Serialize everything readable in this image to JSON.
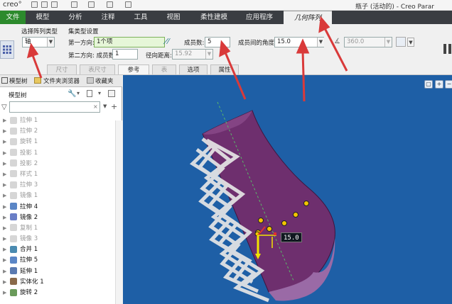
{
  "titlebar": {
    "logo": "creo°",
    "window_title": "瓶子 (活动的) - Creo Parar"
  },
  "ribbon": {
    "tabs": [
      "文件",
      "模型",
      "分析",
      "注释",
      "工具",
      "视图",
      "柔性建模",
      "应用程序"
    ],
    "active_tab": "几何阵列"
  },
  "panel": {
    "pattern_type_label": "选择阵列类型",
    "pattern_type_value": "轴",
    "set_type_label": "集类型设置",
    "dir1_label": "第一方向:",
    "dir1_value": "1个项",
    "members_label1": "成员数:",
    "members_value1": "5",
    "angle_label": "成员间的角度:",
    "angle_value": "15.0",
    "angle_extent_value": "360.0",
    "dir2_label": "第二方向: 成员数:",
    "dir2_value": "1",
    "radial_label": "径向距离:",
    "radial_value": "15.92",
    "subtabs": [
      "尺寸",
      "表尺寸",
      "参考",
      "表",
      "选项",
      "属性"
    ]
  },
  "nav": {
    "tabs": [
      "模型树",
      "文件夹浏览器",
      "收藏夹"
    ],
    "tree_header": "模型树",
    "search_placeholder": ""
  },
  "tree": [
    {
      "label": "拉伸 1",
      "state": "gray",
      "icon": "extrude-icon"
    },
    {
      "label": "拉伸 2",
      "state": "gray",
      "icon": "extrude-icon"
    },
    {
      "label": "旋转 1",
      "state": "gray",
      "icon": "revolve-icon"
    },
    {
      "label": "投影 1",
      "state": "gray",
      "icon": "projection-icon"
    },
    {
      "label": "投影 2",
      "state": "gray",
      "icon": "projection-icon"
    },
    {
      "label": "样式 1",
      "state": "gray",
      "icon": "style-icon"
    },
    {
      "label": "拉伸 3",
      "state": "gray",
      "icon": "extrude-icon"
    },
    {
      "label": "镜像 1",
      "state": "gray",
      "icon": "mirror-icon"
    },
    {
      "label": "拉伸 4",
      "state": "dark",
      "icon": "extrude-icon"
    },
    {
      "label": "镜像 2",
      "state": "dark",
      "icon": "mirror-icon"
    },
    {
      "label": "复制 1",
      "state": "gray",
      "icon": "copy-icon"
    },
    {
      "label": "镜像 3",
      "state": "gray",
      "icon": "mirror-icon"
    },
    {
      "label": "合并 1",
      "state": "dark",
      "icon": "merge-icon"
    },
    {
      "label": "拉伸 5",
      "state": "dark",
      "icon": "extrude-icon"
    },
    {
      "label": "延伸 1",
      "state": "dark",
      "icon": "extend-icon"
    },
    {
      "label": "实体化 1",
      "state": "dark",
      "icon": "solidify-icon"
    },
    {
      "label": "旋转 2",
      "state": "dark",
      "icon": "revolve-icon"
    }
  ],
  "viewport": {
    "angle_callout": "15.0"
  },
  "colors": {
    "file_tab": "#2c8a2c",
    "viewport_bg": "#1e5fa6",
    "surface": "#6e2f6e",
    "arrow": "#d93a3a"
  }
}
